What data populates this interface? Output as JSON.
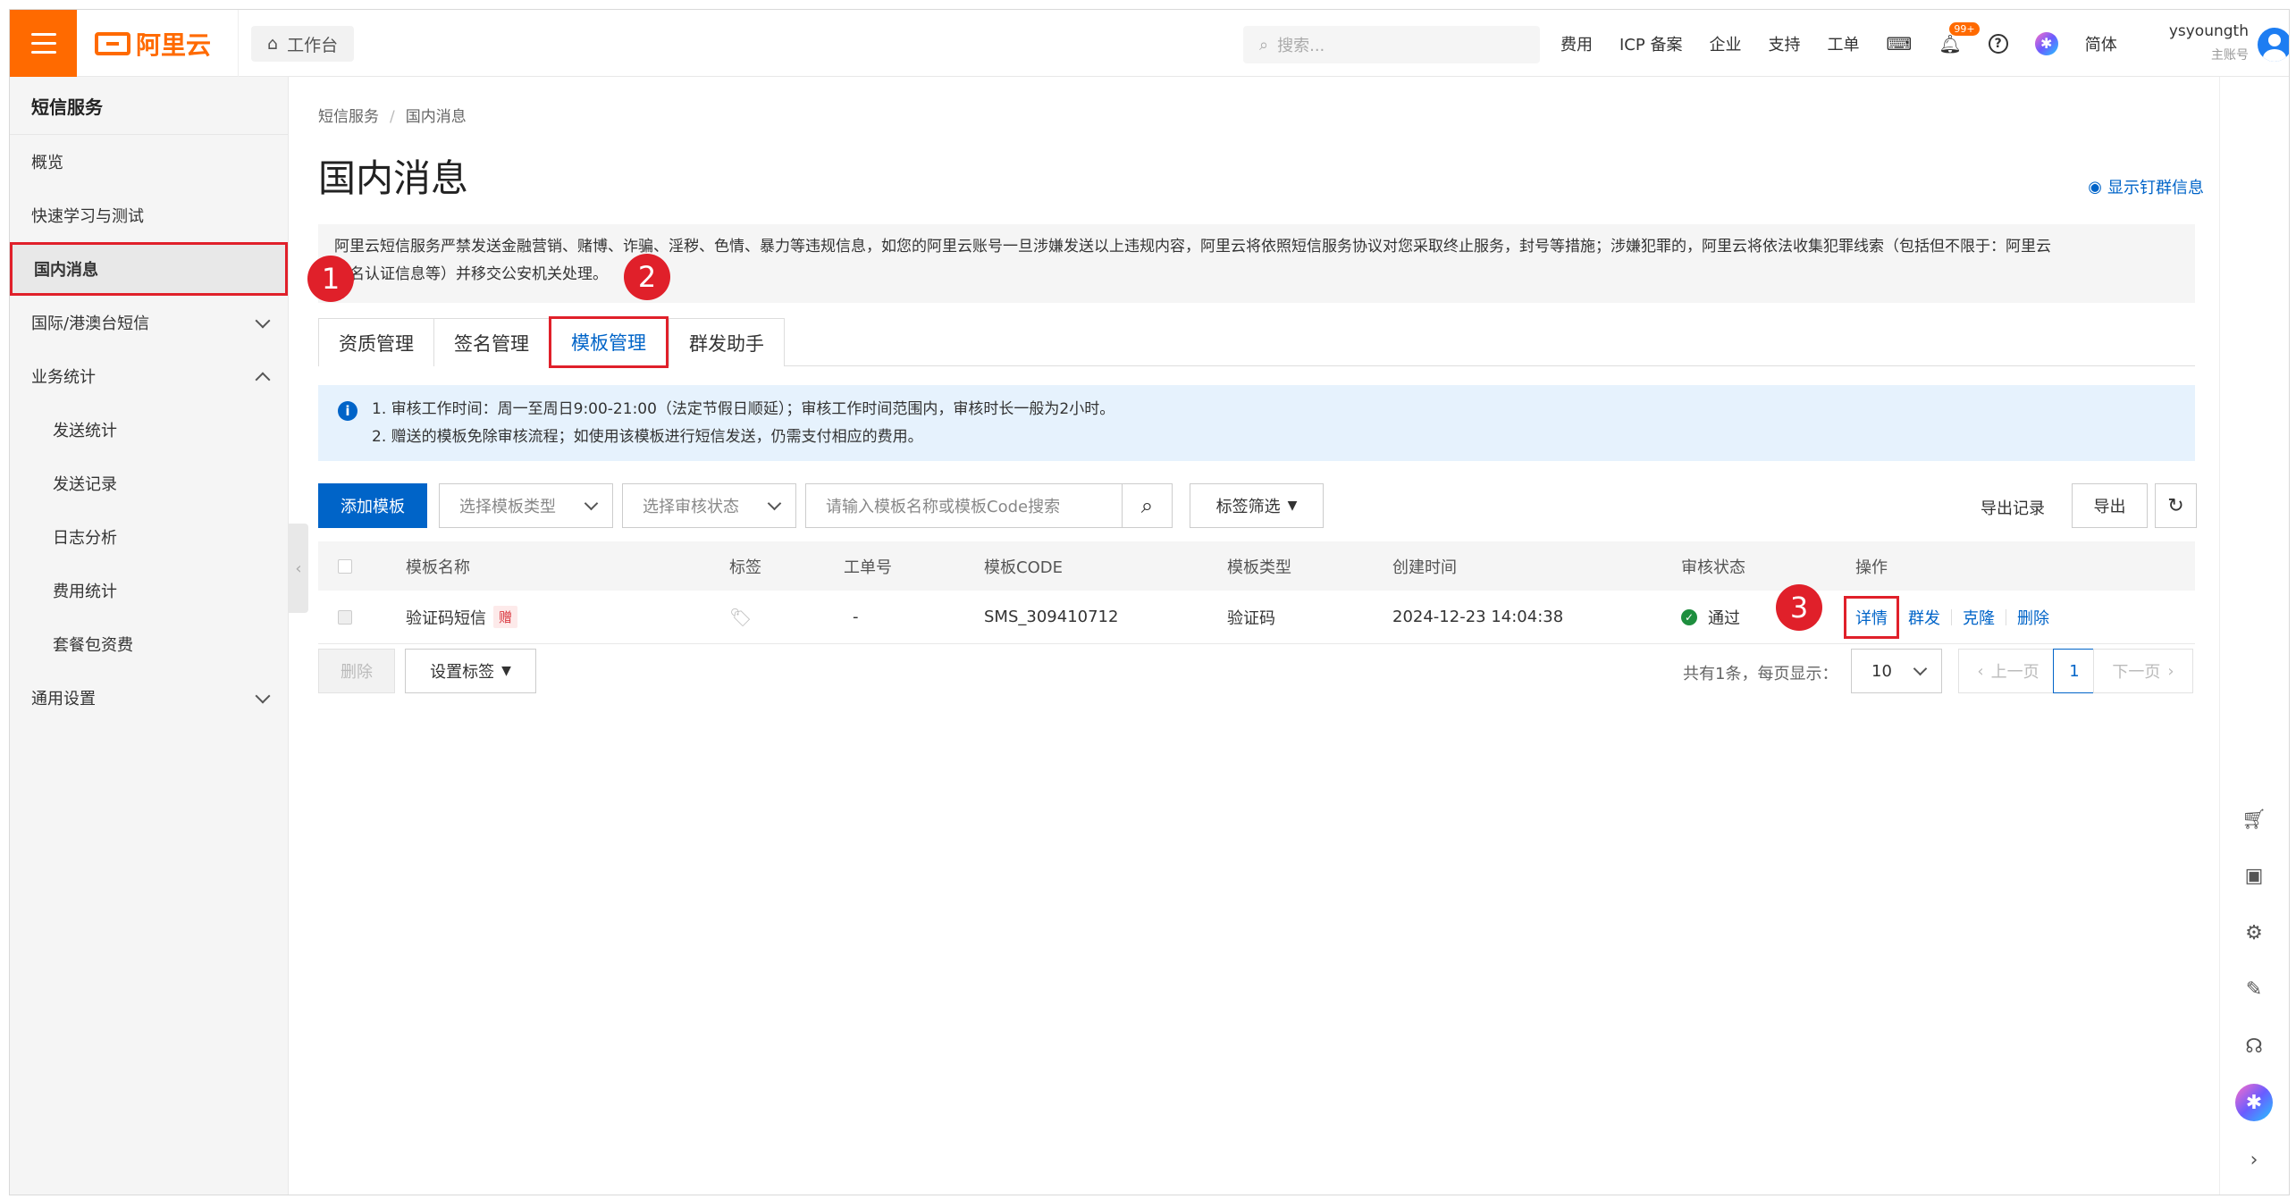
{
  "topbar": {
    "logo": "阿里云",
    "workbench": "工作台",
    "search_placeholder": "搜索...",
    "nav": [
      "费用",
      "ICP 备案",
      "企业",
      "支持",
      "工单"
    ],
    "bell_badge": "99+",
    "lang": "简体",
    "username": "ysyoungth",
    "account_type": "主账号"
  },
  "sidebar": {
    "title": "短信服务",
    "items": [
      {
        "label": "概览"
      },
      {
        "label": "快速学习与测试"
      },
      {
        "label": "国内消息"
      },
      {
        "label": "国际/港澳台短信"
      },
      {
        "label": "业务统计"
      },
      {
        "label": "发送统计"
      },
      {
        "label": "发送记录"
      },
      {
        "label": "日志分析"
      },
      {
        "label": "费用统计"
      },
      {
        "label": "套餐包资费"
      },
      {
        "label": "通用设置"
      }
    ]
  },
  "main": {
    "breadcrumb": [
      "短信服务",
      "国内消息"
    ],
    "title": "国内消息",
    "dingtalk_link": "显示钉群信息",
    "notice_line1": "阿里云短信服务严禁发送金融营销、赌博、诈骗、淫秽、色情、暴力等违规信息，如您的阿里云账号一旦涉嫌发送以上违规内容，阿里云将依照短信服务协议对您采取终止服务，封号等措施；涉嫌犯罪的，阿里云将依法收集犯罪线索（包括但不限于：阿里云",
    "notice_line2": "实名认证信息等）并移交公安机关处理。",
    "tabs": [
      "资质管理",
      "签名管理",
      "模板管理",
      "群发助手"
    ],
    "info_line1": "1. 审核工作时间：周一至周日9:00-21:00（法定节假日顺延）；审核工作时间范围内，审核时长一般为2小时。",
    "info_line2": "2. 赠送的模板免除审核流程；如使用该模板进行短信发送，仍需支付相应的费用。",
    "toolbar": {
      "add": "添加模板",
      "type_select": "选择模板类型",
      "status_select": "选择审核状态",
      "search_placeholder": "请输入模板名称或模板Code搜索",
      "tag_filter": "标签筛选",
      "export_log": "导出记录",
      "export": "导出"
    },
    "table": {
      "headers": [
        "模板名称",
        "标签",
        "工单号",
        "模板CODE",
        "模板类型",
        "创建时间",
        "审核状态",
        "操作"
      ],
      "rows": [
        {
          "name": "验证码短信",
          "gift": "赠",
          "ticket": "-",
          "code": "SMS_309410712",
          "type": "验证码",
          "created": "2024-12-23 14:04:38",
          "status": "通过",
          "actions": [
            "详情",
            "群发",
            "克隆",
            "删除"
          ]
        }
      ]
    },
    "footer": {
      "delete": "删除",
      "set_tag": "设置标签",
      "total": "共有1条，每页显示：",
      "page_size": "10",
      "prev": "上一页",
      "page": "1",
      "next": "下一页"
    }
  },
  "markers": [
    "1",
    "2",
    "3"
  ],
  "colors": {
    "brand": "#ff6a00",
    "link": "#0064c8",
    "highlight": "#e0202a"
  }
}
